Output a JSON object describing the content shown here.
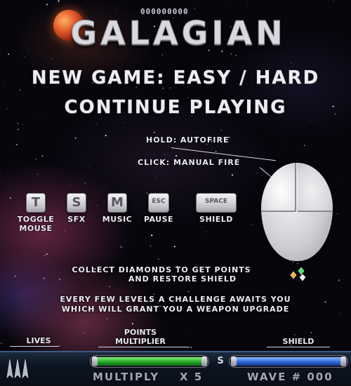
{
  "logo": {
    "title": "GALAGIAN",
    "score_digits": "000000000"
  },
  "menu": {
    "new_game": "NEW GAME: EASY / HARD",
    "continue": "CONTINUE PLAYING"
  },
  "mouse_hints": {
    "hold": "HOLD: AUTOFIRE",
    "click": "CLICK: MANUAL FIRE"
  },
  "keys": [
    {
      "key": "T",
      "label": "TOGGLE\nMOUSE"
    },
    {
      "key": "S",
      "label": "SFX"
    },
    {
      "key": "M",
      "label": "MUSIC"
    },
    {
      "key": "ESC",
      "label": "PAUSE"
    },
    {
      "key": "SPACE",
      "label": "SHIELD"
    }
  ],
  "info": {
    "diamonds_line1": "COLLECT DIAMONDS TO GET POINTS",
    "diamonds_line2": "AND RESTORE SHIELD",
    "challenge_line1": "EVERY FEW LEVELS A CHALLENGE AWAITS YOU",
    "challenge_line2": "WHICH WILL GRANT YOU A WEAPON UPGRADE"
  },
  "hud": {
    "lives_label": "LIVES",
    "points_label_line1": "POINTS",
    "points_label_line2": "MULTIPLIER",
    "shield_label": "SHIELD",
    "multiplier_letter": "S",
    "multiply_text": "MULTIPLY",
    "multiply_value": "X 5",
    "wave_text": "WAVE # 000",
    "lives_count": 3,
    "multiplier_fill": 1.0,
    "shield_fill": 1.0
  },
  "colors": {
    "multiplier_bar": "#22a024",
    "shield_bar": "#2a64d0",
    "planet": "#e0582a"
  }
}
